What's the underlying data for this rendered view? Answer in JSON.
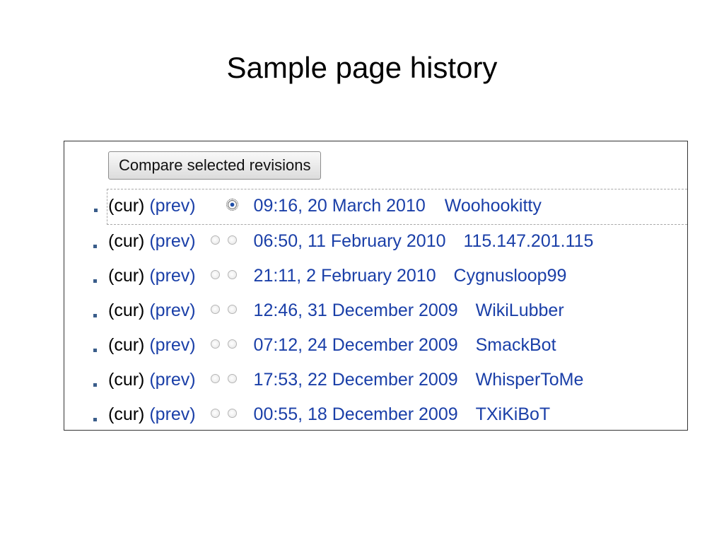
{
  "title": "Sample page history",
  "compare_button": "Compare selected revisions",
  "colors": {
    "link": "#1a3fa8",
    "text": "#000000",
    "bullet": "#3a5d8a"
  },
  "revisions": [
    {
      "cur": "(cur)",
      "prev": "(prev)",
      "date": "09:16, 20 March 2010",
      "user": "Woohookitty",
      "cur_is_link": false,
      "prev_is_link": true,
      "radios": "second-only-selected"
    },
    {
      "cur": "(cur)",
      "prev": "(prev)",
      "date": "06:50, 11 February 2010",
      "user": "115.147.201.115",
      "radios": "both"
    },
    {
      "cur": "(cur)",
      "prev": "(prev)",
      "date": "21:11, 2 February 2010",
      "user": "Cygnusloop99",
      "radios": "both"
    },
    {
      "cur": "(cur)",
      "prev": "(prev)",
      "date": "12:46, 31 December 2009",
      "user": "WikiLubber",
      "radios": "both"
    },
    {
      "cur": "(cur)",
      "prev": "(prev)",
      "date": "07:12, 24 December 2009",
      "user": "SmackBot",
      "radios": "both"
    },
    {
      "cur": "(cur)",
      "prev": "(prev)",
      "date": "17:53, 22 December 2009",
      "user": "WhisperToMe",
      "radios": "both"
    },
    {
      "cur": "(cur)",
      "prev": "(prev)",
      "date": "00:55, 18 December 2009",
      "user": "TXiKiBoT",
      "radios": "both"
    }
  ]
}
